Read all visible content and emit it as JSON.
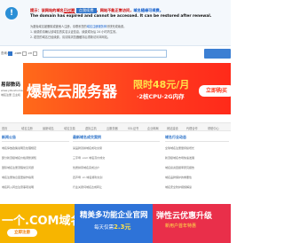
{
  "notice": {
    "prefix": "提示：该网站的域名",
    "domain": "已过期",
    "badge": "点我续费",
    "middle": "，网站不能正常访问，",
    "tail": "域名随缘可续费。",
    "english": "The domain has expired and cannot be accessed. It can be restored after renewal.",
    "line3_prefix": "为避免域名被删除或被他人注册，请联系您的",
    "line3_link": "域名注册服务商",
    "line3_suffix": "尽快完成续费。",
    "line4": "1. 续费前请确认该域名的实名认证信息，续费成功后 24 小时内生效。",
    "line5": "2. 若您的域名已经续费，请清除浏览器缓存后重新访问本网站。"
  },
  "search": {
    "prefix": "查询：",
    "options": [
      ".com",
      ".cn",
      ".net"
    ]
  },
  "logo": {
    "name": "易部数码",
    "sub1": "www.yibushuma.com",
    "sub2": "域名注册 云主机"
  },
  "banner": {
    "title": "爆款云服务器",
    "price": "限时48元/月",
    "spec": "·2核CPU·2G内存",
    "cta": "立即购买"
  },
  "tabs": [
    "首页",
    "域名注册",
    "最新域名",
    "域名交易",
    "虚拟主机",
    "云服务器",
    "SSL证书",
    "企业邮局",
    "网站建设",
    "代理合作",
    "帮助中心"
  ],
  "columns": [
    {
      "head": "新闻公告",
      "items": [
        "域名停放政策说明及处理规定",
        "部分新顶级域名价格调整通知",
        "国际域名注册流程常见问题",
        "域名注册信息变更操作指南",
        "域名转入转出注意事项说明"
      ]
    },
    {
      "head": "最新域名成交案例",
      "items": [
        "某品牌双拼域名成功交易",
        "三字母 .com 域名高价成交",
        "优质拼音域名完成过户",
        "四声母 .cn 域名顺利交割",
        "行业关键词域名达成转让"
      ]
    },
    {
      "head": "域名行业动态",
      "items": [
        "全球域名注册量持续增长",
        "新顶级域名市场快速发展",
        "域名投资回报率研究报告",
        "域名品牌保护的重要性",
        "域名安全防护措施解读"
      ]
    }
  ],
  "ads": {
    "a1_title": "一个.COM域名",
    "a1_btn": "立即注册",
    "a2_title": "精美多功能企业官网",
    "a2_sub_prefix": "每天仅需",
    "a2_price": "2.3元",
    "a3_title": "弹性云优惠升级",
    "a3_sub": "新用户首年特惠"
  },
  "colors": {
    "accent": "#2f74c9",
    "banner": "#ff3b1f",
    "ad1": "#f7b500",
    "ad2": "#2e73d8",
    "ad3": "#e92f4a"
  }
}
